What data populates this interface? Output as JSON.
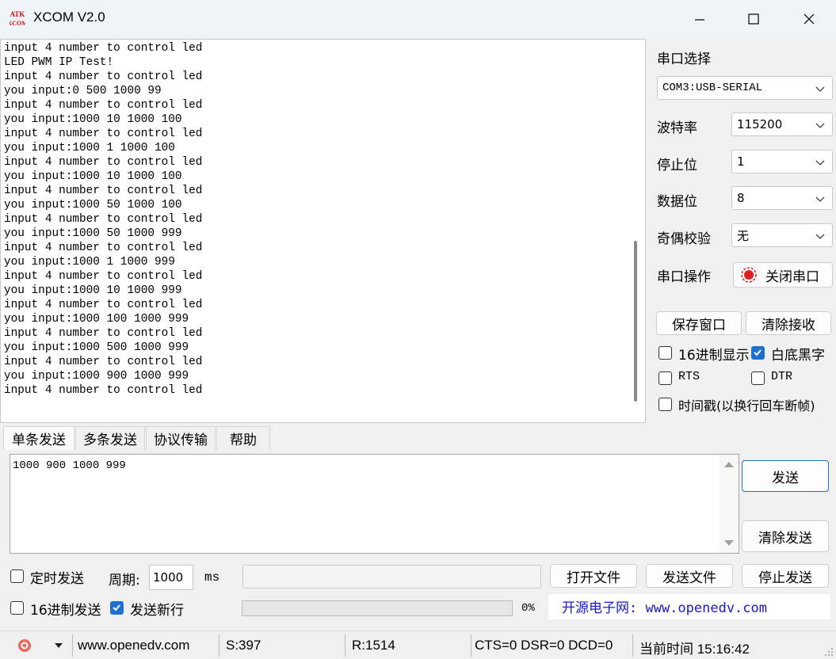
{
  "window": {
    "title": "XCOM V2.0",
    "logo_text_top": "ATK",
    "logo_text_bottom": "XCOM",
    "controls": [
      "minimize-icon",
      "maximize-icon",
      "close-icon"
    ]
  },
  "receive": {
    "lines": [
      "input 4 number to control led",
      "LED PWM IP Test!",
      "input 4 number to control led",
      "you input:0 500 1000 99",
      "input 4 number to control led",
      "you input:1000 10 1000 100",
      "input 4 number to control led",
      "you input:1000 1 1000 100",
      "input 4 number to control led",
      "you input:1000 10 1000 100",
      "input 4 number to control led",
      "you input:1000 50 1000 100",
      "input 4 number to control led",
      "you input:1000 50 1000 999",
      "input 4 number to control led",
      "you input:1000 1 1000 999",
      "input 4 number to control led",
      "you input:1000 10 1000 999",
      "input 4 number to control led",
      "you input:1000 100 1000 999",
      "input 4 number to control led",
      "you input:1000 500 1000 999",
      "input 4 number to control led",
      "you input:1000 900 1000 999",
      "input 4 number to control led"
    ]
  },
  "settings": {
    "port_label": "串口选择",
    "port_value": "COM3:USB-SERIAL",
    "baud_label": "波特率",
    "baud_value": "115200",
    "stop_label": "停止位",
    "stop_value": "1",
    "data_label": "数据位",
    "data_value": "8",
    "parity_label": "奇偶校验",
    "parity_value": "无",
    "op_label": "串口操作",
    "op_button": "关闭串口",
    "save_window": "保存窗口",
    "clear_receive": "清除接收",
    "hex_display": "16进制显示",
    "hex_display_checked": false,
    "white_black": "白底黑字",
    "white_black_checked": true,
    "rts": "RTS",
    "rts_checked": false,
    "dtr": "DTR",
    "dtr_checked": false,
    "timestamp": "时间戳(以换行回车断帧)",
    "timestamp_checked": false
  },
  "tabs": [
    {
      "label": "单条发送",
      "active": true
    },
    {
      "label": "多条发送",
      "active": false
    },
    {
      "label": "协议传输",
      "active": false
    },
    {
      "label": "帮助",
      "active": false
    }
  ],
  "send": {
    "text": "1000 900 1000 999",
    "send_button": "发送",
    "clear_send": "清除发送",
    "timed_send": "定时发送",
    "timed_send_checked": false,
    "period_label": "周期:",
    "period_value": "1000",
    "period_unit": "ms",
    "open_file": "打开文件",
    "send_file": "发送文件",
    "stop_send": "停止发送",
    "hex_send": "16进制发送",
    "hex_send_checked": false,
    "send_newline": "发送新行",
    "send_newline_checked": true,
    "progress_text": "0%",
    "progress_fraction": 0,
    "website_banner": "开源电子网: www.openedv.com"
  },
  "status": {
    "website": "www.openedv.com",
    "sent": "S:397",
    "received": "R:1514",
    "lines_state": "CTS=0 DSR=0 DCD=0",
    "time": "当前时间 15:16:42"
  },
  "colors": {
    "accent": "#1f6fd1",
    "banner_text": "#1a1acc",
    "record_red": "#e02020"
  }
}
